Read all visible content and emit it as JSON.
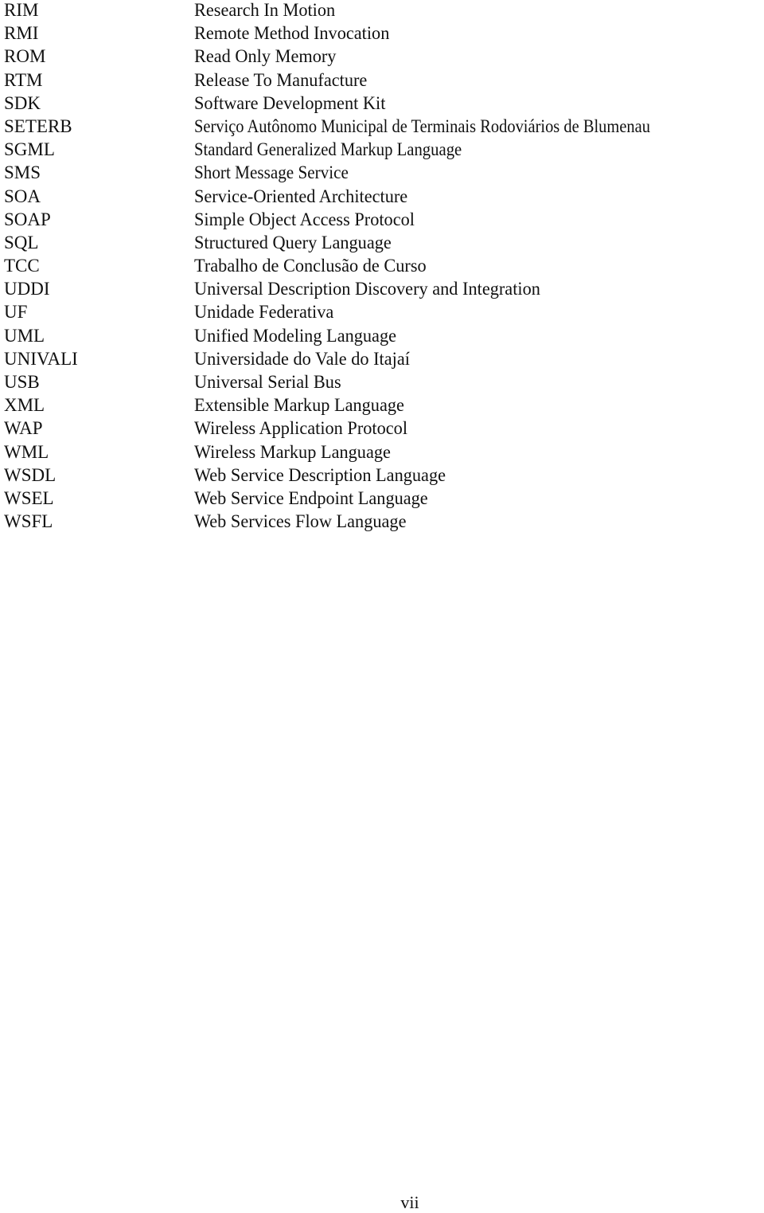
{
  "page": {
    "number": "vii"
  },
  "abbreviations": [
    {
      "term": "RIM",
      "definition": "Research In Motion"
    },
    {
      "term": "RMI",
      "definition": "Remote Method Invocation"
    },
    {
      "term": "ROM",
      "definition": "Read Only Memory"
    },
    {
      "term": "RTM",
      "definition": "Release To Manufacture"
    },
    {
      "term": "SDK",
      "definition": "Software Development Kit"
    },
    {
      "term": "SETERB",
      "definition": "Serviço Autônomo Municipal de Terminais Rodoviários de Blumenau"
    },
    {
      "term": "SGML",
      "definition": "Standard Generalized Markup Language"
    },
    {
      "term": "SMS",
      "definition": "Short Message Service"
    },
    {
      "term": "SOA",
      "definition": "Service-Oriented Architecture"
    },
    {
      "term": "SOAP",
      "definition": "Simple Object Access Protocol"
    },
    {
      "term": "SQL",
      "definition": "Structured Query Language"
    },
    {
      "term": "TCC",
      "definition": "Trabalho de Conclusão de Curso"
    },
    {
      "term": "UDDI",
      "definition": "Universal Description Discovery and Integration"
    },
    {
      "term": "UF",
      "definition": "Unidade Federativa"
    },
    {
      "term": "UML",
      "definition": "Unified Modeling Language"
    },
    {
      "term": "UNIVALI",
      "definition": "Universidade do Vale do Itajaí"
    },
    {
      "term": "USB",
      "definition": "Universal Serial Bus"
    },
    {
      "term": "XML",
      "definition": "Extensible Markup Language"
    },
    {
      "term": "WAP",
      "definition": "Wireless Application Protocol"
    },
    {
      "term": "WML",
      "definition": "Wireless Markup Language"
    },
    {
      "term": "WSDL",
      "definition": "Web Service Description Language"
    },
    {
      "term": "WSEL",
      "definition": "Web Service Endpoint Language"
    },
    {
      "term": "WSFL",
      "definition": "Web Services Flow Language"
    }
  ]
}
